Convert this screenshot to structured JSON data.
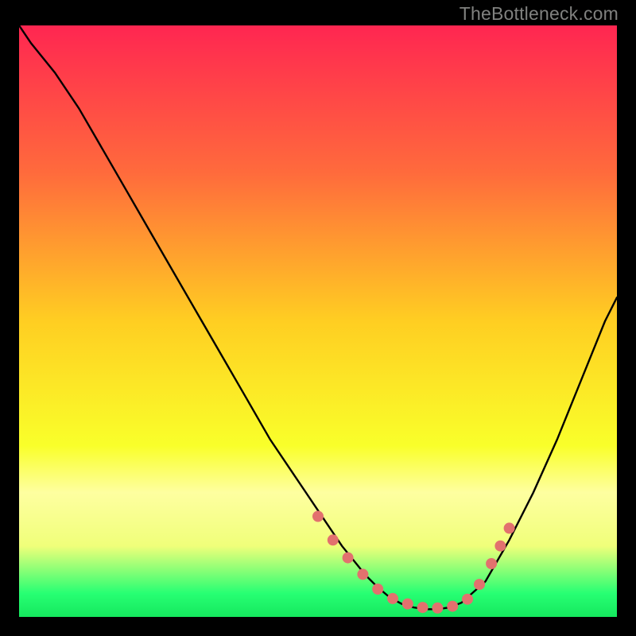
{
  "attribution": "TheBottleneck.com",
  "chart_data": {
    "type": "line",
    "title": "",
    "xlabel": "",
    "ylabel": "",
    "xlim": [
      0,
      100
    ],
    "ylim": [
      0,
      100
    ],
    "background_gradient": {
      "direction": "vertical",
      "stops": [
        {
          "y": 100,
          "color": "#ff2651"
        },
        {
          "y": 75,
          "color": "#ff6b3c"
        },
        {
          "y": 50,
          "color": "#ffce22"
        },
        {
          "y": 29,
          "color": "#f9ff2a"
        },
        {
          "y": 21,
          "color": "#feffa0"
        },
        {
          "y": 12,
          "color": "#f0ff7a"
        },
        {
          "y": 4,
          "color": "#27ff73"
        },
        {
          "y": 0,
          "color": "#15e85e"
        }
      ]
    },
    "series": [
      {
        "name": "bottleneck-curve",
        "color": "#000000",
        "x": [
          0,
          2,
          6,
          10,
          14,
          18,
          22,
          26,
          30,
          34,
          38,
          42,
          46,
          50,
          54,
          58,
          60,
          62,
          64,
          66,
          68,
          70,
          72,
          74,
          78,
          82,
          86,
          90,
          94,
          98,
          100
        ],
        "y": [
          100,
          97,
          92,
          86,
          79,
          72,
          65,
          58,
          51,
          44,
          37,
          30,
          24,
          18,
          12,
          7,
          5,
          3.3,
          2.2,
          1.6,
          1.3,
          1.3,
          1.6,
          2.4,
          6,
          13,
          21,
          30,
          40,
          50,
          54
        ]
      }
    ],
    "markers": {
      "name": "highlight-points",
      "color": "#e2716e",
      "radius": 7,
      "x": [
        50,
        52.5,
        55,
        57.5,
        60,
        62.5,
        65,
        67.5,
        70,
        72.5,
        75,
        77,
        79,
        80.5,
        82
      ],
      "y": [
        17,
        13,
        10,
        7.2,
        4.7,
        3.1,
        2.2,
        1.6,
        1.5,
        1.8,
        3.0,
        5.5,
        9,
        12,
        15
      ]
    }
  }
}
